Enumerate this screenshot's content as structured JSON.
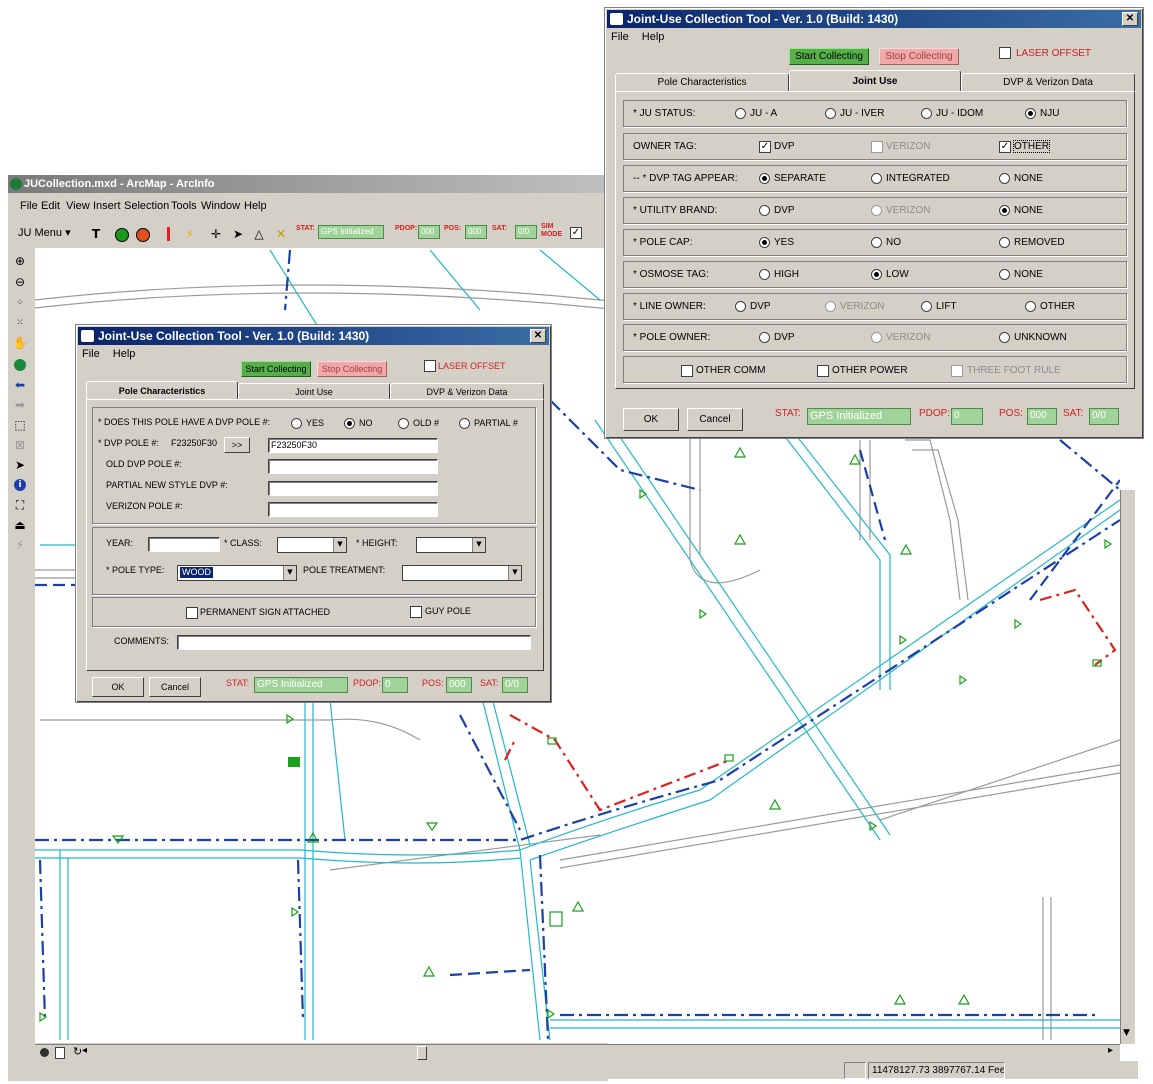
{
  "arcmap": {
    "title": "JUCollection.mxd - ArcMap - ArcInfo",
    "menus": [
      "File",
      "Edit",
      "View",
      "Insert",
      "Selection",
      "Tools",
      "Window",
      "Help"
    ],
    "ju_menu": "JU Menu",
    "stat_label": "STAT:",
    "stat_value": "GPS Initialized",
    "pdop_label": "PDOP:",
    "pdop_value": "000",
    "pos_label": "POS:",
    "pos_value": "000",
    "sat_label": "SAT:",
    "sat_value": "0/0",
    "sim_label": "SIM MODE",
    "coords": "11478127.73  3897767.14 Feet"
  },
  "dialog_front": {
    "title": "Joint-Use Collection Tool - Ver. 1.0 (Build: 1430)",
    "menus": [
      "File",
      "Help"
    ],
    "start_label": "Start Collecting",
    "stop_label": "Stop Collecting",
    "laser_label": "LASER OFFSET",
    "tabs": [
      "Pole Characteristics",
      "Joint Use",
      "DVP & Verizon Data"
    ],
    "q_dvp_pole": "* DOES THIS POLE HAVE A DVP POLE #:",
    "opt_yes": "YES",
    "opt_no": "NO",
    "opt_old": "OLD #",
    "opt_partial": "PARTIAL #",
    "dvp_pole_label": "* DVP POLE #:",
    "dvp_pole_code": "F23250F30",
    "copy_btn": ">>",
    "dvp_pole_value": "F23250F30",
    "old_dvp_label": "OLD DVP POLE #:",
    "partial_label": "PARTIAL NEW STYLE DVP #:",
    "verizon_label": "VERIZON POLE #:",
    "year_label": "YEAR:",
    "class_label": "* CLASS:",
    "height_label": "* HEIGHT:",
    "pole_type_label": "* POLE TYPE:",
    "pole_type_value": "WOOD",
    "pole_treatment_label": "POLE TREATMENT:",
    "perm_sign_label": "PERMANENT SIGN ATTACHED",
    "guy_pole_label": "GUY POLE",
    "comments_label": "COMMENTS:",
    "ok": "OK",
    "cancel": "Cancel",
    "stat_label": "STAT:",
    "stat_value": "GPS Initialized",
    "pdop_label": "PDOP:",
    "pdop_value": "0",
    "pos_label": "POS:",
    "pos_value": "000",
    "sat_label": "SAT:",
    "sat_value": "0/0"
  },
  "dialog_back": {
    "title": "Joint-Use Collection Tool - Ver. 1.0 (Build: 1430)",
    "menus": [
      "File",
      "Help"
    ],
    "start_label": "Start Collecting",
    "stop_label": "Stop Collecting",
    "laser_label": "LASER OFFSET",
    "tabs": [
      "Pole Characteristics",
      "Joint Use",
      "DVP & Verizon Data"
    ],
    "rows": [
      {
        "label": "* JU STATUS:",
        "options": [
          "JU - A",
          "JU - IVER",
          "JU - IDOM",
          "NJU"
        ],
        "selected": 3
      },
      {
        "label": "OWNER TAG:",
        "options": [
          "DVP",
          "VERIZON",
          "OTHER"
        ],
        "checked": [
          true,
          false,
          true
        ],
        "kind": "check"
      },
      {
        "label": "-- * DVP TAG APPEAR:",
        "options": [
          "SEPARATE",
          "INTEGRATED",
          "NONE"
        ],
        "selected": 0
      },
      {
        "label": "* UTILITY BRAND:",
        "options": [
          "DVP",
          "VERIZON",
          "NONE"
        ],
        "selected": 2
      },
      {
        "label": "* POLE CAP:",
        "options": [
          "YES",
          "NO",
          "REMOVED"
        ],
        "selected": 0
      },
      {
        "label": "* OSMOSE TAG:",
        "options": [
          "HIGH",
          "LOW",
          "NONE"
        ],
        "selected": 1
      },
      {
        "label": "* LINE OWNER:",
        "options": [
          "DVP",
          "VERIZON",
          "LIFT",
          "OTHER"
        ],
        "selected": -1
      },
      {
        "label": "* POLE OWNER:",
        "options": [
          "DVP",
          "VERIZON",
          "UNKNOWN"
        ],
        "selected": -1
      }
    ],
    "other_comm": "OTHER COMM",
    "other_power": "OTHER POWER",
    "three_foot": "THREE FOOT RULE",
    "ok": "OK",
    "cancel": "Cancel",
    "stat_label": "STAT:",
    "stat_value": "GPS Initialized",
    "pdop_label": "PDOP:",
    "pdop_value": "0",
    "pos_label": "POS:",
    "pos_value": "000",
    "sat_label": "SAT:",
    "sat_value": "0/0"
  },
  "colors": {
    "title_bar": "#0a246a",
    "road_cyan": "#22b8c8",
    "road_gray": "#9a9a9a",
    "line_blue": "#1c3fa8",
    "line_red": "#e02020",
    "marker_green": "#1aa01a"
  }
}
